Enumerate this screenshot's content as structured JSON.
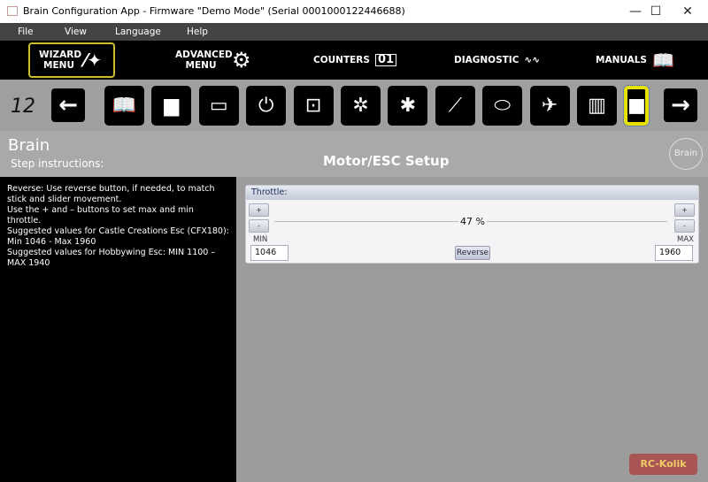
{
  "window": {
    "title": "Brain Configuration App - Firmware \"Demo Mode\" (Serial 0001000122446688)",
    "minimize": "—",
    "maximize": "☐",
    "close": "✕"
  },
  "menu": [
    "File",
    "View",
    "Language",
    "Help"
  ],
  "nav": {
    "wizard": "WIZARD MENU",
    "advanced": "ADVANCED MENU",
    "counters": "COUNTERS",
    "counters_icon": "01",
    "diagnostic": "DIAGNOSTIC",
    "manuals": "MANUALS"
  },
  "toolbar": {
    "step_number": "12",
    "steps": [
      "manual-book",
      "servo",
      "receiver-module",
      "plug",
      "transmitter",
      "swashplate-tilted",
      "swashplate",
      "tail-rotor",
      "helicopter-body",
      "helicopter-formation",
      "safety-vest",
      "esc-motor"
    ],
    "active_step": "esc-motor"
  },
  "header": {
    "app": "Brain",
    "step_instructions": "Step instructions:",
    "page_title": "Motor/ESC Setup",
    "logo": "Brain"
  },
  "instructions": [
    "Reverse: Use reverse button, if needed, to match stick and slider movement.",
    "Use the + and – buttons to set max and min throttle.",
    "Suggested values for Castle Creations Esc (CFX180): Min 1046 - Max 1960",
    "Suggested values for Hobbywing Esc: MIN 1100 – MAX 1940"
  ],
  "throttle": {
    "title": "Throttle:",
    "percent": "47 %",
    "value_percent": 47,
    "min_label": "MIN",
    "max_label": "MAX",
    "min_value": "1046",
    "max_value": "1960",
    "reverse": "Reverse",
    "plus": "+",
    "minus": "-"
  },
  "watermark": "RC-Kolik",
  "colors": {
    "active_step_border": "#e8e000",
    "nav_bg": "#000000",
    "wizard_border": "#cbbf2e"
  }
}
